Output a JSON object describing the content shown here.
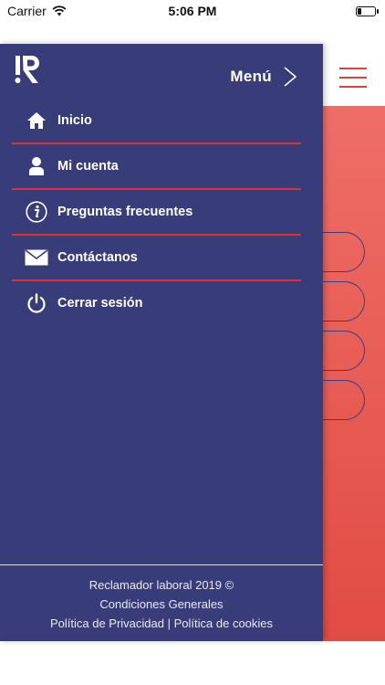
{
  "status_bar": {
    "carrier": "Carrier",
    "time": "5:06 PM",
    "battery_level_fraction": 0.25
  },
  "drawer": {
    "menu_title": "Menú",
    "items": [
      {
        "label": "Inicio",
        "icon": "home-icon"
      },
      {
        "label": "Mi cuenta",
        "icon": "user-icon"
      },
      {
        "label": "Preguntas frecuentes",
        "icon": "info-icon"
      },
      {
        "label": "Contáctanos",
        "icon": "mail-icon"
      },
      {
        "label": "Cerrar sesión",
        "icon": "power-icon"
      }
    ],
    "footer": {
      "copyright": "Reclamador laboral 2019 ©",
      "conditions": "Condiciones Generales",
      "privacy": "Política de Privacidad",
      "separator": "|",
      "cookies": "Política de cookies"
    }
  },
  "colors": {
    "drawer_bg": "#383d7a",
    "divider": "#d7343a",
    "accent_red": "#e14c43"
  }
}
